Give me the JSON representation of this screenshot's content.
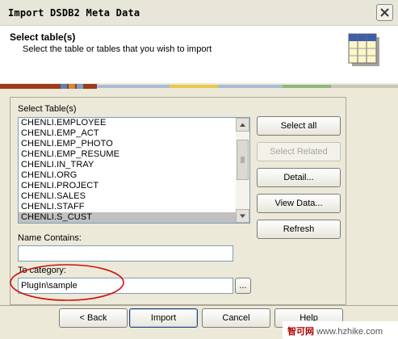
{
  "window": {
    "title": "Import DSDB2 Meta Data"
  },
  "header": {
    "title": "Select table(s)",
    "subtitle": "Select the table or tables that you wish to import"
  },
  "group": {
    "label": "Select Table(s)",
    "tables": [
      "CHENLI.EMPLOYEE",
      "CHENLI.EMP_ACT",
      "CHENLI.EMP_PHOTO",
      "CHENLI.EMP_RESUME",
      "CHENLI.IN_TRAY",
      "CHENLI.ORG",
      "CHENLI.PROJECT",
      "CHENLI.SALES",
      "CHENLI.STAFF",
      "CHENLI.S_CUST"
    ],
    "selected_index": 9
  },
  "name_contains": {
    "label": "Name Contains:",
    "value": ""
  },
  "to_category": {
    "label": "To category:",
    "value": "PlugIn\\sample",
    "browse_label": "..."
  },
  "side_buttons": {
    "select_all": "Select all",
    "select_related": "Select Related",
    "detail": "Detail...",
    "view_data": "View Data...",
    "refresh": "Refresh"
  },
  "footer": {
    "back": "< Back",
    "import": "Import",
    "cancel": "Cancel",
    "help": "Help"
  },
  "watermark": {
    "site_cn": "智可网",
    "url": "www.hzhike.com"
  },
  "colors": {
    "dialog_bg": "#ece9d8",
    "annotation_circle": "#d01010",
    "selection": "#c0c0c0",
    "listbox_border": "#7f9db9"
  }
}
